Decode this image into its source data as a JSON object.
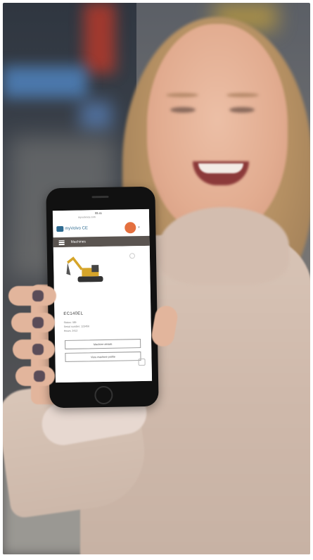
{
  "phone": {
    "status_time": "09:41",
    "url": "my.volvoce.com",
    "app_logo": "myVolvo CE",
    "nav_title": "Machines",
    "machine_model": "EC140EL",
    "meta_lines": [
      "Status: Idle",
      "Serial number: 123456",
      "Hours: 2412"
    ],
    "button_primary": "Machine details",
    "button_secondary": "View machine profile"
  },
  "colors": {
    "brand": "#2e6b91",
    "nav": "#5a5450",
    "avatar": "#e4703f",
    "excavator_yellow": "#d6a52a"
  }
}
